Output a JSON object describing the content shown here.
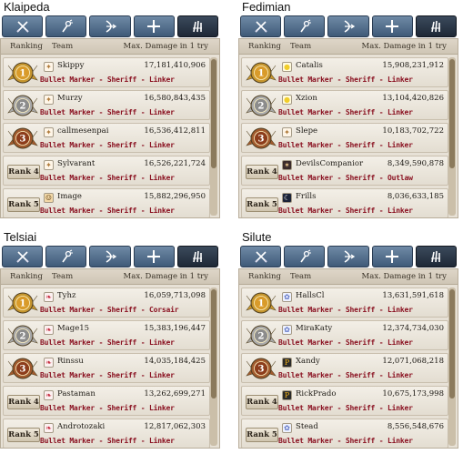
{
  "header_labels": {
    "ranking": "Ranking",
    "team": "Team",
    "damage": "Max. Damage in 1 try"
  },
  "colors": {
    "tab_bg": "#4f6a88",
    "tab_active_bg": "#263240",
    "team_text": "#8a1020",
    "gold": "#c6962e",
    "silver": "#a9a9a9",
    "bronze": "#a15a2e"
  },
  "tab_icons": [
    "swords-icon",
    "staff-icon",
    "bow-icon",
    "cross-icon",
    "claws-icon"
  ],
  "panels": [
    {
      "title": "Klaipeda",
      "rows": [
        {
          "rank": "1",
          "name": "Skippy",
          "damage": "17,181,410,906",
          "team": "Bullet Marker - Sheriff - Linker",
          "avatar": "shield"
        },
        {
          "rank": "2",
          "name": "Murzy",
          "damage": "16,580,843,435",
          "team": "Bullet Marker - Sheriff - Linker",
          "avatar": "shield"
        },
        {
          "rank": "3",
          "name": "callmesenpai",
          "damage": "16,536,412,811",
          "team": "Bullet Marker - Sheriff - Linker",
          "avatar": "shield"
        },
        {
          "rank": "Rank 4",
          "name": "Sylvarant",
          "damage": "16,526,221,724",
          "team": "Bullet Marker - Sheriff - Linker",
          "avatar": "shield"
        },
        {
          "rank": "Rank 5",
          "name": "Image",
          "damage": "15,882,296,950",
          "team": "Bullet Marker - Sheriff - Linker",
          "avatar": "face"
        }
      ]
    },
    {
      "title": "Fedimian",
      "rows": [
        {
          "rank": "1",
          "name": "Catalis",
          "damage": "15,908,231,912",
          "team": "Bullet Marker - Sheriff - Linker",
          "avatar": "chick"
        },
        {
          "rank": "2",
          "name": "Xzion",
          "damage": "13,104,420,826",
          "team": "Bullet Marker - Sheriff - Linker",
          "avatar": "chick"
        },
        {
          "rank": "3",
          "name": "Slepe",
          "damage": "10,183,702,722",
          "team": "Bullet Marker - Sheriff - Linker",
          "avatar": "shield"
        },
        {
          "rank": "Rank 4",
          "name": "DevilsCompanior",
          "damage": "8,349,590,878",
          "team": "Bullet Marker - Sheriff - Outlaw",
          "avatar": "dark"
        },
        {
          "rank": "Rank 5",
          "name": "Frills",
          "damage": "8,036,633,185",
          "team": "Bullet Marker - Sheriff - Linker",
          "avatar": "moon"
        }
      ]
    },
    {
      "title": "Telsiai",
      "rows": [
        {
          "rank": "1",
          "name": "Tyhz",
          "damage": "16,059,713,098",
          "team": "Bullet Marker - Sheriff - Corsair",
          "avatar": "wing"
        },
        {
          "rank": "2",
          "name": "Mage15",
          "damage": "15,383,196,447",
          "team": "Bullet Marker - Sheriff - Linker",
          "avatar": "wing"
        },
        {
          "rank": "3",
          "name": "Rinssu",
          "damage": "14,035,184,425",
          "team": "Bullet Marker - Sheriff - Linker",
          "avatar": "wing"
        },
        {
          "rank": "Rank 4",
          "name": "Pastaman",
          "damage": "13,262,699,271",
          "team": "Bullet Marker - Sheriff - Linker",
          "avatar": "wing"
        },
        {
          "rank": "Rank 5",
          "name": "Androtozaki",
          "damage": "12,817,062,303",
          "team": "Bullet Marker - Sheriff - Linker",
          "avatar": "wing"
        }
      ]
    },
    {
      "title": "Silute",
      "rows": [
        {
          "rank": "1",
          "name": "HallsCl",
          "damage": "13,631,591,618",
          "team": "Bullet Marker - Sheriff - Linker",
          "avatar": "seal"
        },
        {
          "rank": "2",
          "name": "MiraKaty",
          "damage": "12,374,734,030",
          "team": "Bullet Marker - Sheriff - Linker",
          "avatar": "seal"
        },
        {
          "rank": "3",
          "name": "Xandy",
          "damage": "12,071,068,218",
          "team": "Bullet Marker - Sheriff - Linker",
          "avatar": "coin"
        },
        {
          "rank": "Rank 4",
          "name": "RickPrado",
          "damage": "10,675,173,998",
          "team": "Bullet Marker - Sheriff - Linker",
          "avatar": "coin"
        },
        {
          "rank": "Rank 5",
          "name": "Stead",
          "damage": "8,556,548,676",
          "team": "Bullet Marker - Sheriff - Linker",
          "avatar": "seal"
        }
      ]
    }
  ]
}
